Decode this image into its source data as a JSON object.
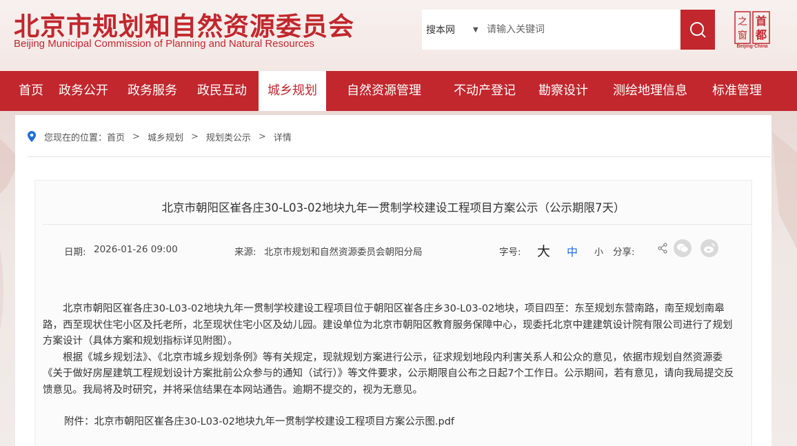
{
  "header": {
    "title": "北京市规划和自然资源委员会",
    "subtitle": "Beijing Municipal Commission of Planning and Natural Resources",
    "logo_text_en": "Beijing·China",
    "logo_chars": [
      "首",
      "都",
      "之",
      "窗"
    ]
  },
  "search": {
    "scope": "搜本网",
    "placeholder": "请输入关键词",
    "icon": "search-icon"
  },
  "nav": {
    "items": [
      {
        "label": "首页"
      },
      {
        "label": "政务公开"
      },
      {
        "label": "政务服务"
      },
      {
        "label": "政民互动"
      },
      {
        "label": "城乡规划"
      },
      {
        "label": "自然资源管理"
      },
      {
        "label": "不动产登记"
      },
      {
        "label": "勘察设计"
      },
      {
        "label": "测绘地理信息"
      },
      {
        "label": "标准管理"
      }
    ],
    "active": "城乡规划"
  },
  "breadcrumb": {
    "prefix": "您现在的位置：",
    "items": [
      "首页",
      "城乡规划",
      "规划类公示",
      "详情"
    ],
    "separator": ">"
  },
  "article": {
    "title": "北京市朝阳区崔各庄30-L03-02地块九年一贯制学校建设工程项目方案公示（公示期限7天）",
    "date_label": "日期:",
    "date": "2026-01-26 09:00",
    "source_label": "来源:",
    "source": "北京市规划和自然资源委员会朝阳分局",
    "font_label": "字号:",
    "font_sizes": [
      "大",
      "中",
      "小"
    ],
    "share_label": "分享:",
    "paragraphs": [
      "北京市朝阳区崔各庄30-L03-02地块九年一贯制学校建设工程项目位于朝阳区崔各庄乡30-L03-02地块，项目四至：东至规划东营南路，南至规划南皋路，西至现状住宅小区及托老所，北至现状住宅小区及幼儿园。建设单位为北京市朝阳区教育服务保障中心，现委托北京中建建筑设计院有限公司进行了规划方案设计（具体方案和规划指标详见附图）。",
      "根据《城乡规划法》、《北京市城乡规划条例》等有关规定，现就规划方案进行公示，征求规划地段内利害关系人和公众的意见，依据市规划自然资源委《关于做好房屋建筑工程规划设计方案批前公众参与的通知（试行）》等文件要求，公示期限自公布之日起7个工作日。公示期间，若有意见，请向我局提交反馈意见。我局将及时研究，并将采信结果在本网站通告。逾期不提交的，视为无意见。"
    ],
    "attachment_label": "附件：",
    "attachment_name": "北京市朝阳区崔各庄30-L03-02地块九年一贯制学校建设工程项目方案公示图.pdf"
  },
  "colors": {
    "brand_red": "#c1272d",
    "active_font_size": "#1e6fd9"
  }
}
